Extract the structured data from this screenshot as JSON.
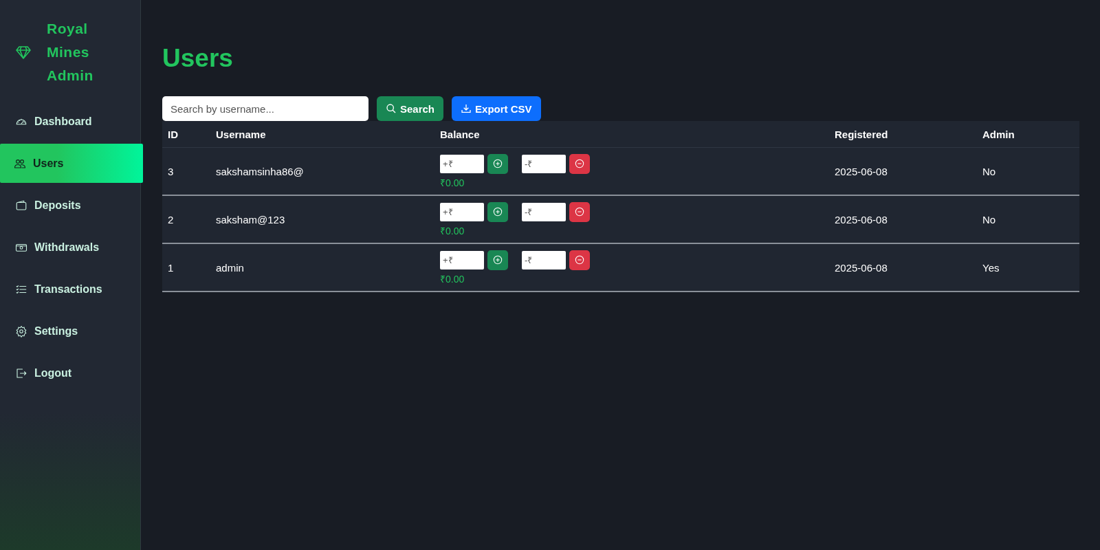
{
  "sidebar": {
    "brand": [
      "Royal",
      "Mines",
      "Admin"
    ],
    "items": [
      {
        "label": "Dashboard",
        "kind": "gauge",
        "selected": false
      },
      {
        "label": "Users",
        "kind": "people",
        "selected": true
      },
      {
        "label": "Deposits",
        "kind": "wallet",
        "selected": false
      },
      {
        "label": "Withdrawals",
        "kind": "cash",
        "selected": false
      },
      {
        "label": "Transactions",
        "kind": "list",
        "selected": false
      },
      {
        "label": "Settings",
        "kind": "gear",
        "selected": false
      },
      {
        "label": "Logout",
        "kind": "exit",
        "selected": false
      }
    ]
  },
  "page_title": "Users",
  "search": {
    "placeholder": "Search by username...",
    "button": "Search"
  },
  "export_button": "Export CSV",
  "table": {
    "columns": [
      "ID",
      "Username",
      "Balance",
      "Registered",
      "Admin"
    ],
    "rows": [
      {
        "id": "3",
        "username": "sakshamsinha86@",
        "add_placeholder": "+₹",
        "sub_placeholder": "-₹",
        "balance": "₹0.00",
        "registered": "2025-06-08",
        "admin": "No"
      },
      {
        "id": "2",
        "username": "saksham@123",
        "add_placeholder": "+₹",
        "sub_placeholder": "-₹",
        "balance": "₹0.00",
        "registered": "2025-06-08",
        "admin": "No"
      },
      {
        "id": "1",
        "username": "admin",
        "add_placeholder": "+₹",
        "sub_placeholder": "-₹",
        "balance": "₹0.00",
        "registered": "2025-06-08",
        "admin": "Yes"
      }
    ]
  }
}
